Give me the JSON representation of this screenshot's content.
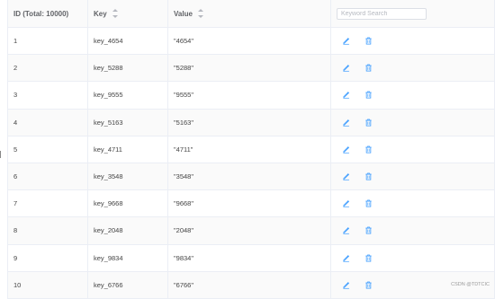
{
  "header": {
    "id_label": "ID (Total: 10000)",
    "key_label": "Key",
    "value_label": "Value",
    "search_placeholder": "Keyword Search"
  },
  "rows": [
    {
      "id": "1",
      "key": "key_4654",
      "value": "\"4654\""
    },
    {
      "id": "2",
      "key": "key_5288",
      "value": "\"5288\""
    },
    {
      "id": "3",
      "key": "key_9555",
      "value": "\"9555\""
    },
    {
      "id": "4",
      "key": "key_5163",
      "value": "\"5163\""
    },
    {
      "id": "5",
      "key": "key_4711",
      "value": "\"4711\""
    },
    {
      "id": "6",
      "key": "key_3548",
      "value": "\"3548\""
    },
    {
      "id": "7",
      "key": "key_9668",
      "value": "\"9668\""
    },
    {
      "id": "8",
      "key": "key_2048",
      "value": "\"2048\""
    },
    {
      "id": "9",
      "key": "key_9834",
      "value": "\"9834\""
    },
    {
      "id": "10",
      "key": "key_6766",
      "value": "\"6766\""
    }
  ],
  "icons": {
    "edit": "edit-icon",
    "delete": "delete-icon"
  },
  "colors": {
    "accent": "#409eff"
  },
  "watermark": "CSDN @TDTCIC"
}
